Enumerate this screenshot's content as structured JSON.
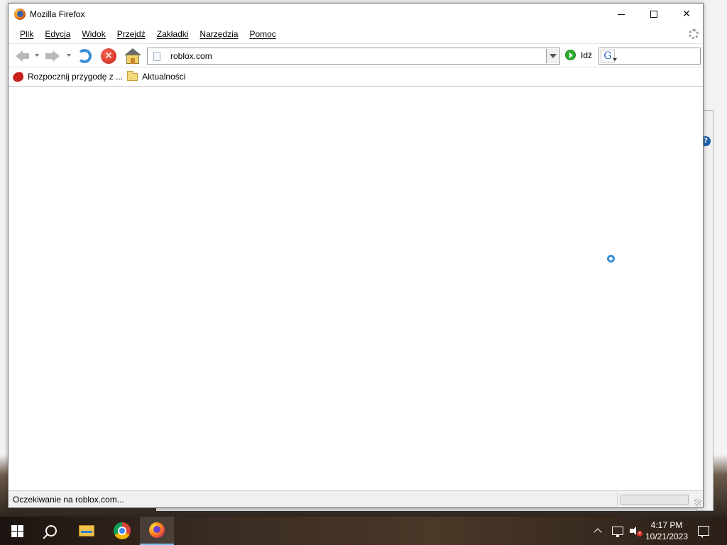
{
  "window": {
    "title": "Mozilla Firefox",
    "controls": {
      "minimize": "–",
      "maximize": "□",
      "close": "✕"
    }
  },
  "menubar": {
    "items": [
      {
        "label": "Plik"
      },
      {
        "label": "Edycja"
      },
      {
        "label": "Widok"
      },
      {
        "label": "Przejdź"
      },
      {
        "label": "Zakładki"
      },
      {
        "label": "Narzędzia"
      },
      {
        "label": "Pomoc"
      }
    ]
  },
  "navbar": {
    "url": "roblox.com",
    "go_label": "Idź",
    "search_engine_letter": "G",
    "search_value": ""
  },
  "bookmarks": [
    {
      "label": "Rozpocznij przygodę z ...",
      "icon": "roblox-icon"
    },
    {
      "label": "Aktualności",
      "icon": "folder-icon"
    }
  ],
  "statusbar": {
    "text": "Oczekiwanie na roblox.com...",
    "progress_fraction": 0
  },
  "taskbar": {
    "pinned": [
      "windows-start-icon",
      "search-icon",
      "file-explorer-icon",
      "chrome-icon",
      "firefox-icon"
    ],
    "active": "firefox-icon",
    "clock_time": "4:17 PM",
    "clock_date": "10/21/2023"
  },
  "background_window": {
    "help_glyph": "?"
  },
  "colors": {
    "taskbar_accent": "#76b9ed",
    "stop_red": "#cc1e12",
    "go_green": "#2fae2f",
    "reload_blue": "#3a8fd6"
  }
}
